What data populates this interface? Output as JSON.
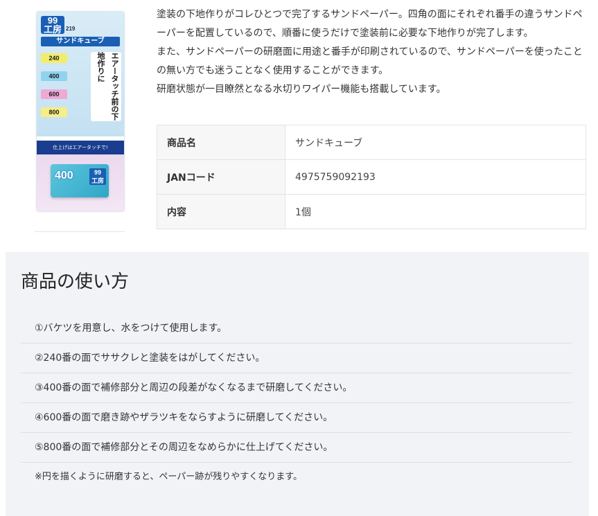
{
  "product_image": {
    "logo_line1": "99",
    "logo_line2": "工房",
    "model_number": "219",
    "product_name": "サンドキューブ",
    "grits": [
      "240",
      "400",
      "600",
      "800"
    ],
    "slogan": "エアータッチ前の下地作りに",
    "band_text": "仕上げはエアータッチで!",
    "block_number": "400",
    "grit_colors": [
      "#f3ec6b",
      "#8fd3ef",
      "#f0a9d6",
      "#f8ee86"
    ]
  },
  "description": {
    "paragraphs": [
      "塗装の下地作りがコレひとつで完了するサンドペーパー。四角の面にそれぞれ番手の違うサンドペーパーを配置しているので、順番に使うだけで塗装前に必要な下地作りが完了します。",
      "また、サンドペーパーの研磨面に用途と番手が印刷されているので、サンドペーパーを使ったことの無い方でも迷うことなく使用することができます。",
      "研磨状態が一目瞭然となる水切りワイパー機能も搭載しています。"
    ]
  },
  "spec": {
    "rows": [
      {
        "label": "商品名",
        "value": "サンドキューブ"
      },
      {
        "label": "JANコード",
        "value": "4975759092193"
      },
      {
        "label": "内容",
        "value": "1個"
      }
    ]
  },
  "usage": {
    "title": "商品の使い方",
    "steps": [
      "①バケツを用意し、水をつけて使用します。",
      "②240番の面でササクレと塗装をはがしてください。",
      "③400番の面で補修部分と周辺の段差がなくなるまで研磨してください。",
      "④600番の面で磨き跡やザラツキをならすように研磨してください。",
      "⑤800番の面で補修部分とその周辺をなめらかに仕上げてください。"
    ],
    "note": "※円を描くように研磨すると、ペーパー跡が残りやすくなります。"
  }
}
